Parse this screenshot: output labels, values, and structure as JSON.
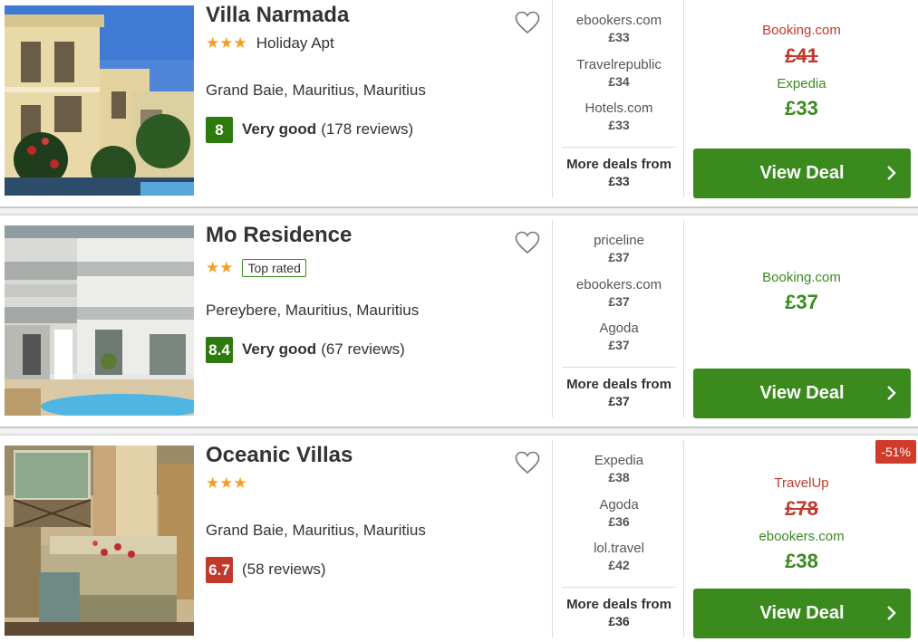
{
  "hotels": [
    {
      "name": "Villa Narmada",
      "stars": "★★★",
      "stars_label": "Holiday Apt",
      "location": "Grand Baie, Mauritius, Mauritius",
      "score": "8",
      "rating_word": "Very good",
      "reviews": "(178 reviews)",
      "deals": [
        {
          "provider": "ebookers.com",
          "price": "£33"
        },
        {
          "provider": "Travelrepublic",
          "price": "£34"
        },
        {
          "provider": "Hotels.com",
          "price": "£33"
        }
      ],
      "more_label": "More deals from",
      "more_price": "£33",
      "old_provider": "Booking.com",
      "old_price": "£41",
      "best_provider": "Expedia",
      "best_price": "£33",
      "cta": "View Deal"
    },
    {
      "name": "Mo Residence",
      "stars": "★★",
      "badge": "Top rated",
      "location": "Pereybere, Mauritius, Mauritius",
      "score": "8.4",
      "rating_word": "Very good",
      "reviews": "(67 reviews)",
      "deals": [
        {
          "provider": "priceline",
          "price": "£37"
        },
        {
          "provider": "ebookers.com",
          "price": "£37"
        },
        {
          "provider": "Agoda",
          "price": "£37"
        }
      ],
      "more_label": "More deals from",
      "more_price": "£37",
      "best_provider": "Booking.com",
      "best_price": "£37",
      "cta": "View Deal"
    },
    {
      "name": "Oceanic Villas",
      "stars": "★★★",
      "location": "Grand Baie, Mauritius, Mauritius",
      "score": "6.7",
      "reviews": "(58 reviews)",
      "deals": [
        {
          "provider": "Expedia",
          "price": "£38"
        },
        {
          "provider": "Agoda",
          "price": "£36"
        },
        {
          "provider": "lol.travel",
          "price": "£42"
        }
      ],
      "more_label": "More deals from",
      "more_price": "£36",
      "discount": "-51%",
      "old_provider": "TravelUp",
      "old_price": "£78",
      "best_provider": "ebookers.com",
      "best_price": "£38",
      "cta": "View Deal"
    }
  ],
  "colors": {
    "accent_green": "#3a8a1e",
    "score_green": "#2d7a0f",
    "score_red": "#c0392b",
    "strike_red": "#c0392b",
    "star_orange": "#f2a024"
  },
  "icons": [
    "favorite-heart-icon",
    "chevron-right-icon",
    "star-icon"
  ]
}
